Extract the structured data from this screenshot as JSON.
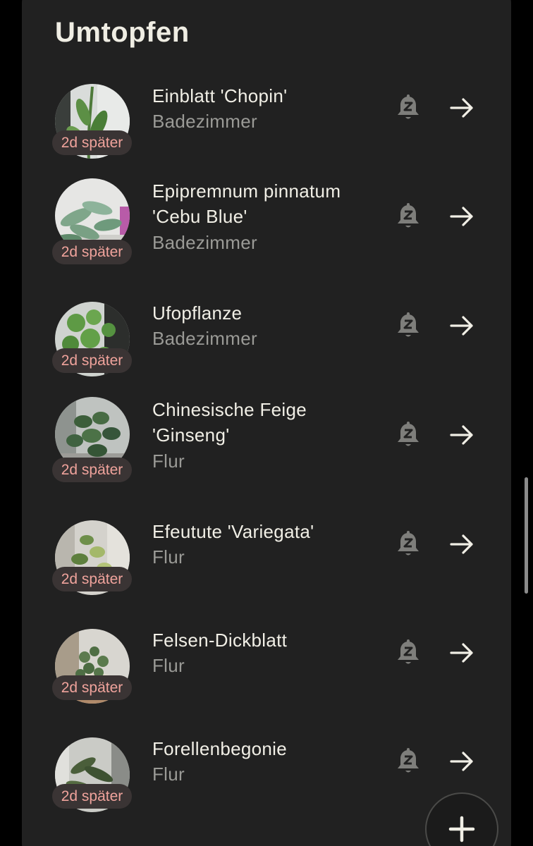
{
  "section": {
    "title": "Umtopfen"
  },
  "plants": [
    {
      "name": "Einblatt 'Chopin'",
      "room": "Badezimmer",
      "due": "2d später"
    },
    {
      "name": "Epipremnum pinnatum 'Cebu Blue'",
      "room": "Badezimmer",
      "due": "2d später"
    },
    {
      "name": "Ufopflanze",
      "room": "Badezimmer",
      "due": "2d später"
    },
    {
      "name": "Chinesische Feige 'Ginseng'",
      "room": "Flur",
      "due": "2d später"
    },
    {
      "name": "Efeutute 'Variegata'",
      "room": "Flur",
      "due": "2d später"
    },
    {
      "name": "Felsen-Dickblatt",
      "room": "Flur",
      "due": "2d später"
    },
    {
      "name": "Forellenbegonie",
      "room": "Flur",
      "due": "2d später"
    }
  ],
  "icons": {
    "snooze": "snooze-bell-icon",
    "open": "arrow-right-icon",
    "add": "plus-icon"
  },
  "colors": {
    "background": "#000000",
    "card": "#212121",
    "badge_background": "#3A3434",
    "badge_text": "#F0A39C",
    "primary_text": "#F1EFE6",
    "secondary_text": "#9A9A96"
  }
}
